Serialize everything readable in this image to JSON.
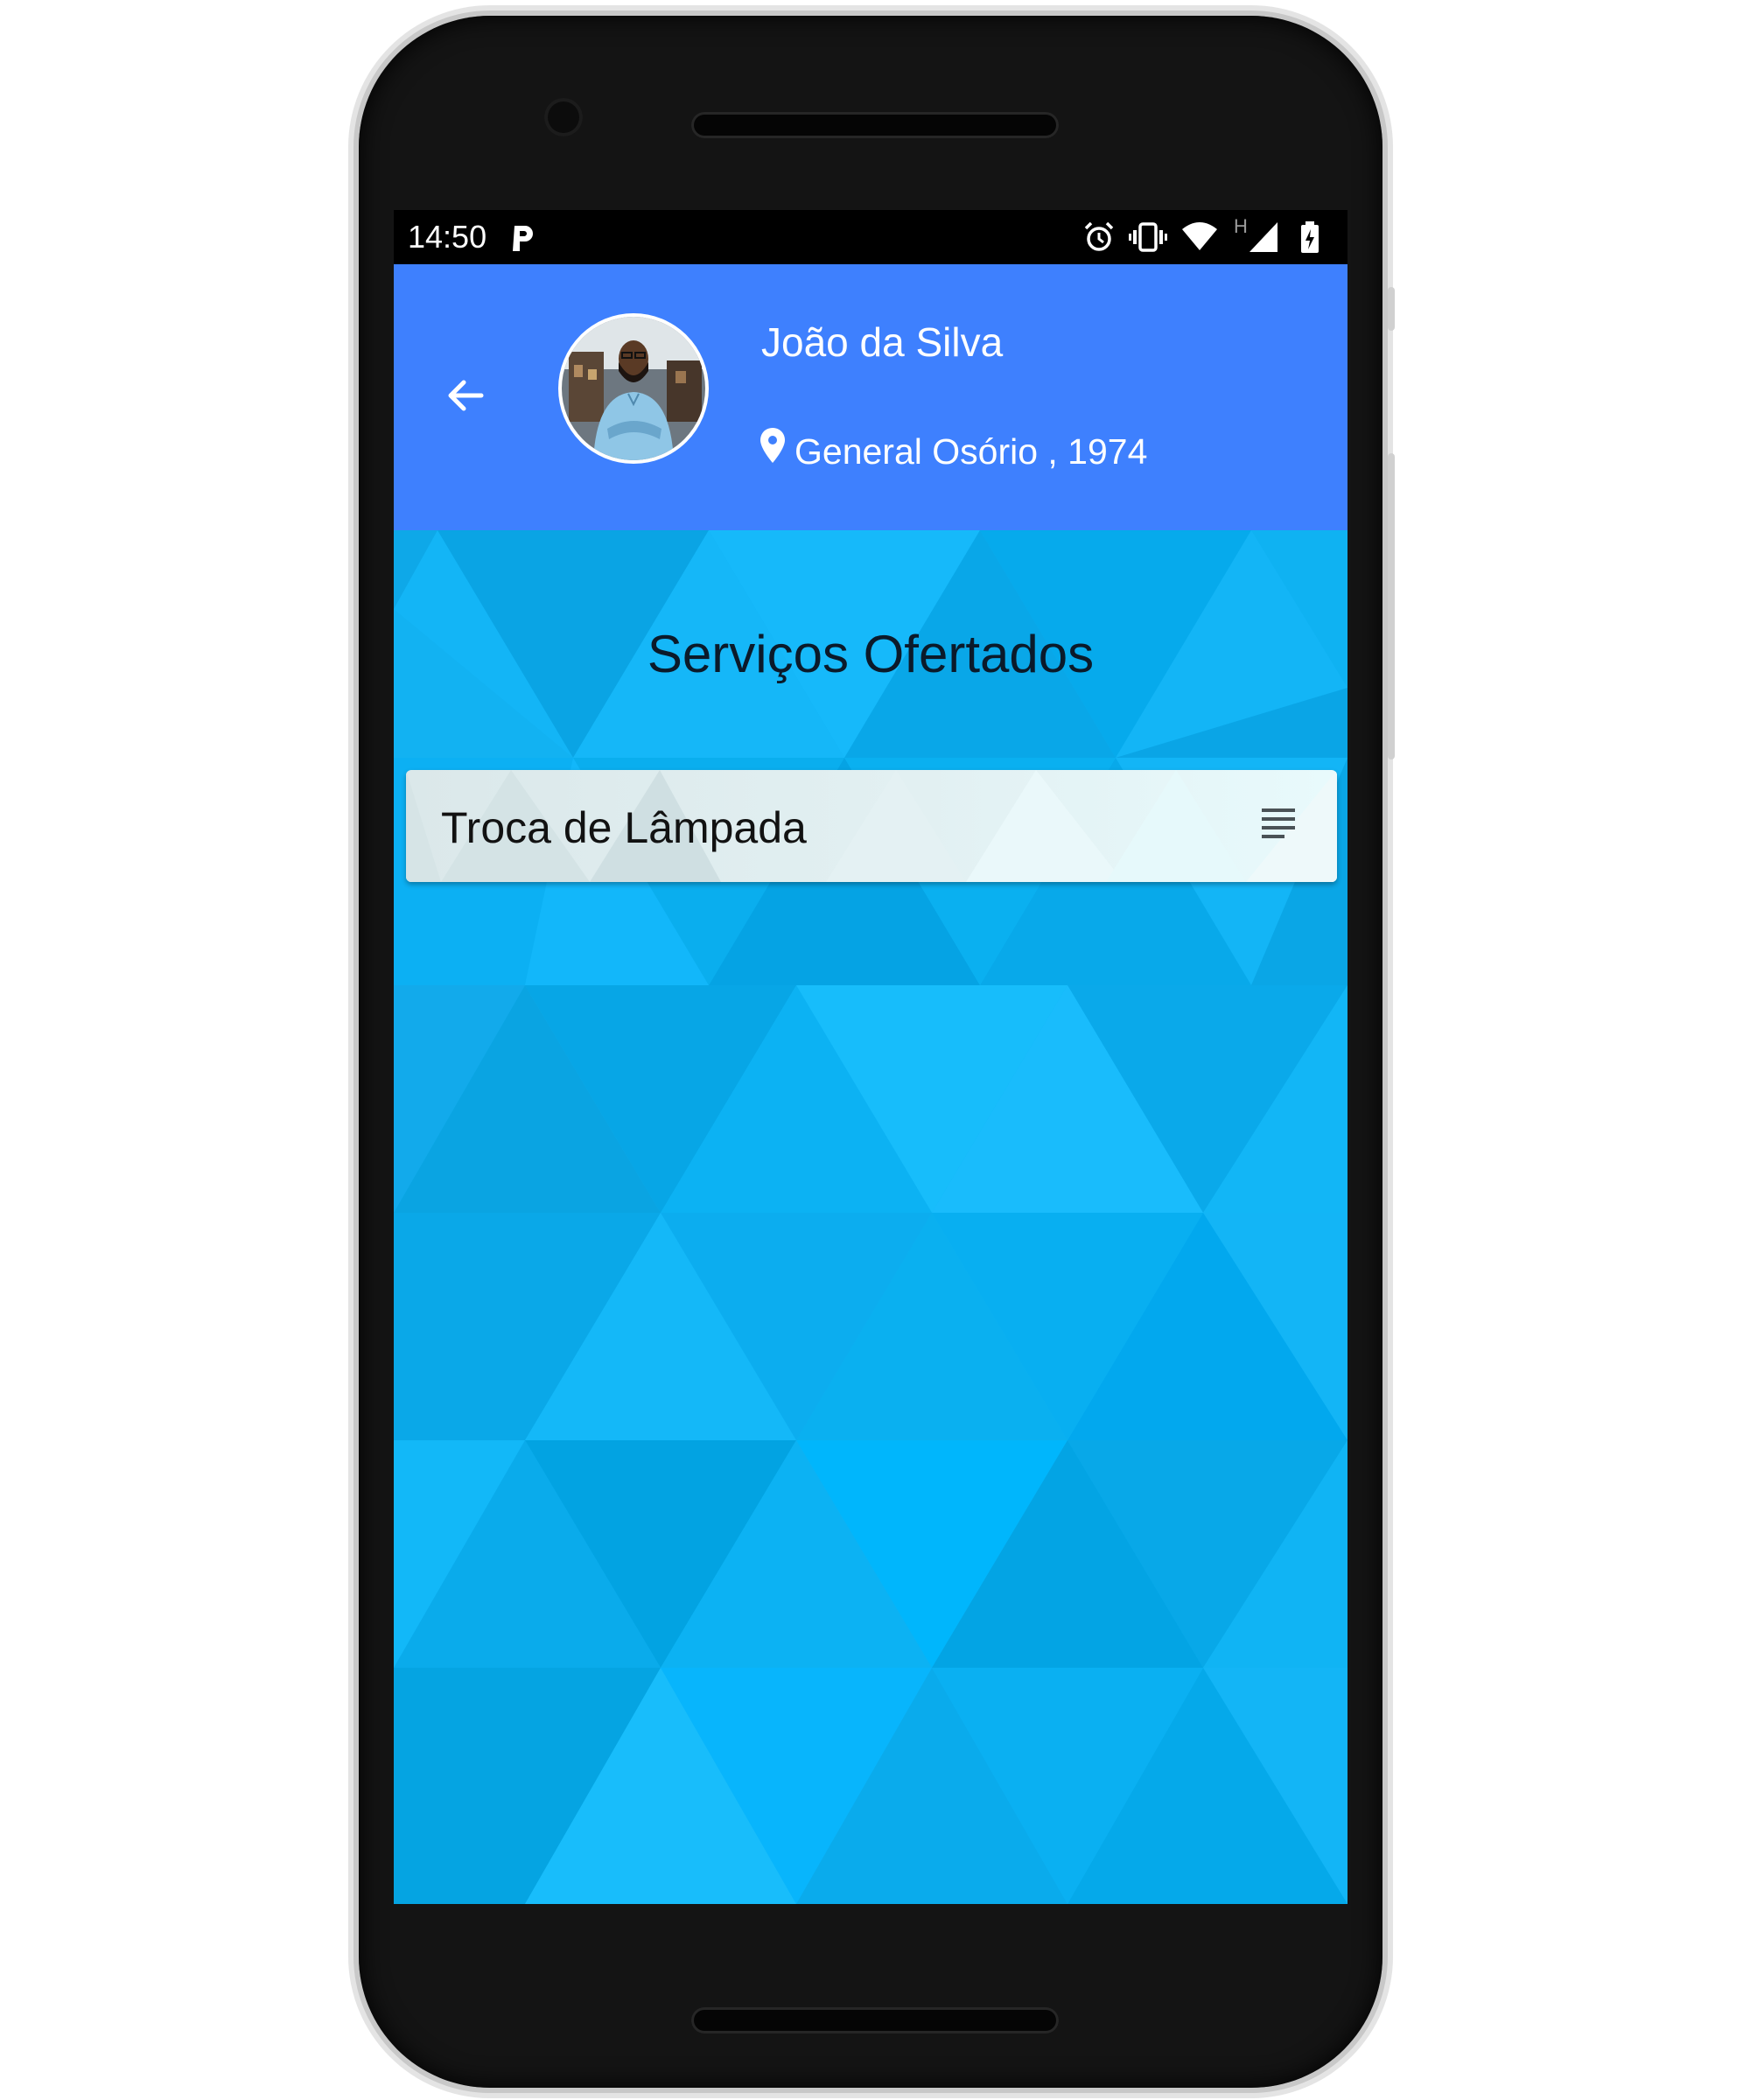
{
  "status_bar": {
    "time": "14:50",
    "icons": [
      "parking-icon",
      "alarm-icon",
      "vibrate-icon",
      "wifi-icon",
      "signal-h-icon",
      "battery-charging-icon"
    ],
    "network_label": "H"
  },
  "header": {
    "back_icon": "arrow-left-icon",
    "avatar_icon": "avatar",
    "user_name": "João da Silva",
    "location_icon": "location-pin-icon",
    "location_text": "General Osório , 1974"
  },
  "main": {
    "section_title": "Serviços Ofertados",
    "services": [
      {
        "label": "Troca de Lâmpada",
        "action_icon": "notes-icon"
      }
    ]
  },
  "colors": {
    "app_bar": "#3e80fe",
    "background": "#10aef0",
    "status_bar": "#000000",
    "card": "#e2f0f2"
  }
}
